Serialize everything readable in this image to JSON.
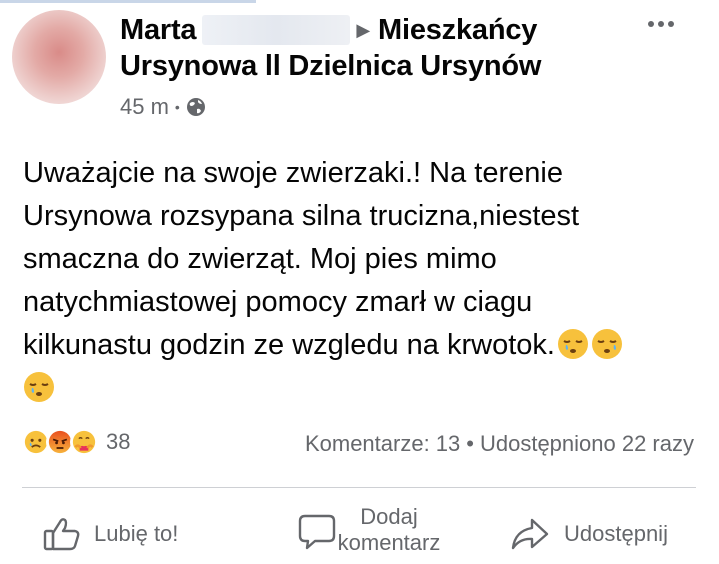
{
  "post": {
    "author_name": "Marta",
    "group_name": "Mieszkańcy",
    "group_line2": "Ursynowa ll Dzielnica Ursynów",
    "time": "45 m",
    "privacy_icon": "globe-icon",
    "text_lines": [
      "Uważajcie na swoje zwierzaki.! Na terenie",
      "Ursynowa rozsypana silna trucizna,niestest",
      "smaczna do zwierząt. Moj pies mimo",
      "natychmiastowej pomocy zmarł w ciagu",
      "kilkunastu godzin ze wzgledu na krwotok."
    ],
    "emoji": "sleepy-face-emoji"
  },
  "reactions": {
    "icons": [
      "sad-reaction",
      "angry-reaction",
      "care-reaction"
    ],
    "count": "38"
  },
  "stats": {
    "comments": "Komentarze: 13",
    "separator": "•",
    "shares": "Udostępniono 22 razy"
  },
  "actions": {
    "like": "Lubię to!",
    "comment_line1": "Dodaj",
    "comment_line2": "komentarz",
    "share": "Udostępnij"
  },
  "colors": {
    "text": "#050505",
    "secondary": "#65676b",
    "divider": "#ced0d4",
    "emoji_yellow": "#f7c13c"
  }
}
